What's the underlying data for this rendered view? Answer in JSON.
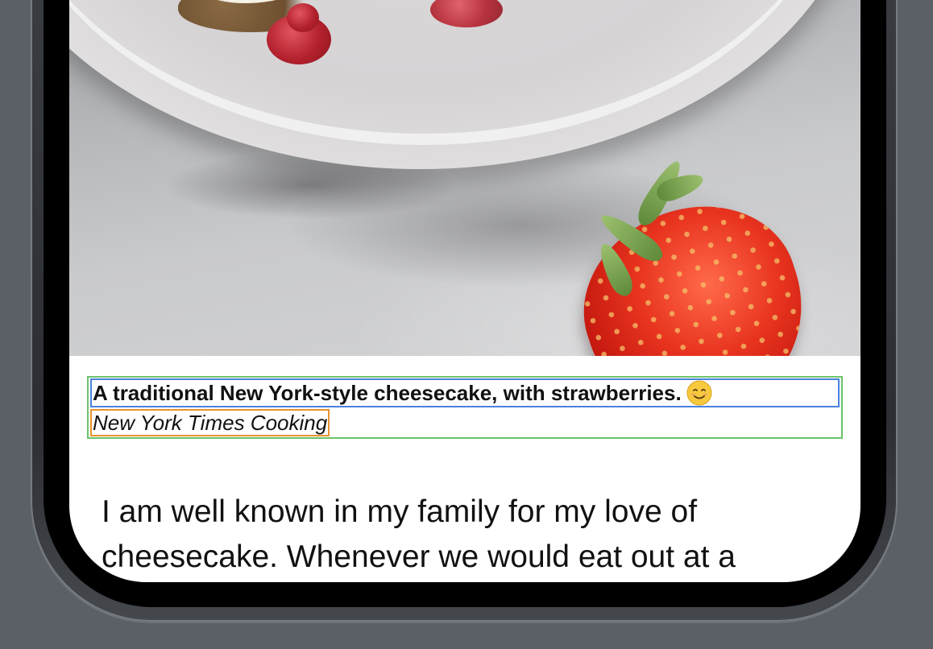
{
  "caption": {
    "title": "A traditional New York-style cheesecake, with strawberries.",
    "title_emoji_icon": "smiling-face-icon",
    "credit": "New York Times Cooking"
  },
  "article": {
    "line1": "I am well known in my family for my love of",
    "line2": "cheesecake. Whenever we would eat out at a"
  },
  "colors": {
    "page_background": "#5b5f66",
    "screen_background": "#ffffff",
    "caption_outline": "#6cc26a",
    "title_outline": "#4a82e0",
    "credit_outline": "#e8922e"
  }
}
